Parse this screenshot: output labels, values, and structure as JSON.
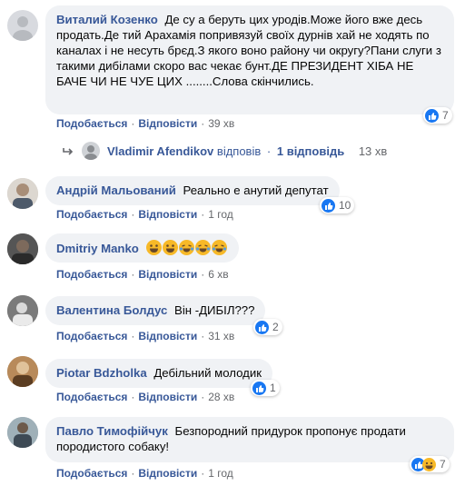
{
  "comments": [
    {
      "author": "Виталий Козенко",
      "text": "Де су а беруть цих уродів.Може його вже десь продать.Де тий Арахамія попривязуй своїх дурнів хай не ходять по каналах і не несуть брєд.З якого воно району чи округу?Пани слуги з такими дибілами скоро вас чекає бунт.ДЕ ПРЕЗИДЕНТ ХІБА НЕ БАЧЕ ЧИ НЕ ЧУЕ ЦИХ ........Слова скінчились.",
      "like": "Подобається",
      "reply": "Відповісти",
      "time": "39 хв",
      "reactions": "7"
    },
    {
      "author": "Андрій Мальований",
      "text": "Реально е анутий депутат",
      "like": "Подобається",
      "reply": "Відповісти",
      "time": "1 год",
      "reactions": "10"
    },
    {
      "author": "Dmitriy Manko",
      "text": "",
      "like": "Подобається",
      "reply": "Відповісти",
      "time": "6 хв",
      "reactions": ""
    },
    {
      "author": "Валентина Болдус",
      "text": "Він -ДИБІЛ???",
      "like": "Подобається",
      "reply": "Відповісти",
      "time": "31 хв",
      "reactions": "2"
    },
    {
      "author": "Piotar Bdzholka",
      "text": "Дебільний молодик",
      "like": "Подобається",
      "reply": "Відповісти",
      "time": "28 хв",
      "reactions": "1"
    },
    {
      "author": "Павло Тимофійчук",
      "text": "Безпородний придурок пропонує продати породистого собаку!",
      "like": "Подобається",
      "reply": "Відповісти",
      "time": "1 год",
      "reactions": "7"
    }
  ],
  "reply_thread": {
    "author": "Vladimir Afendikov",
    "action": "відповів",
    "count": "1 відповідь",
    "time": "13 хв"
  },
  "separator": "·",
  "colors": {
    "link": "#385898",
    "bubble": "#f0f2f5",
    "like_blue": "#1877f2",
    "haha_yellow": "#f7b928",
    "meta": "#65676b"
  }
}
